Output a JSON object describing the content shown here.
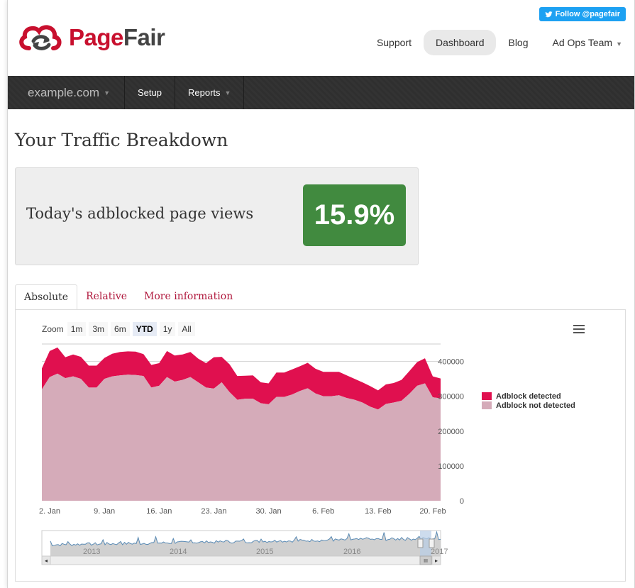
{
  "header": {
    "follow_label": "Follow @pagefair",
    "logo": {
      "part1": "Page",
      "part2": "Fair"
    },
    "nav": [
      {
        "label": "Support",
        "active": false
      },
      {
        "label": "Dashboard",
        "active": true
      },
      {
        "label": "Blog",
        "active": false
      },
      {
        "label": "Ad Ops Team",
        "active": false,
        "dropdown": true
      }
    ]
  },
  "subnav": {
    "site": "example.com",
    "setup": "Setup",
    "reports": "Reports"
  },
  "page_title": "Your Traffic Breakdown",
  "stat": {
    "label": "Today's adblocked page views",
    "value": "15.9%",
    "color": "#418a3f"
  },
  "tabs": [
    "Absolute",
    "Relative",
    "More information"
  ],
  "zoom": {
    "label": "Zoom",
    "options": [
      "1m",
      "3m",
      "6m",
      "YTD",
      "1y",
      "All"
    ],
    "selected": "YTD"
  },
  "chart_data": {
    "type": "area",
    "stacked": true,
    "x": [
      "1/1",
      "1/2",
      "1/3",
      "1/4",
      "1/5",
      "1/6",
      "1/7",
      "1/8",
      "1/9",
      "1/10",
      "1/11",
      "1/12",
      "1/13",
      "1/14",
      "1/15",
      "1/16",
      "1/17",
      "1/18",
      "1/19",
      "1/20",
      "1/21",
      "1/22",
      "1/23",
      "1/24",
      "1/25",
      "1/26",
      "1/27",
      "1/28",
      "1/29",
      "1/30",
      "1/31",
      "2/1",
      "2/2",
      "2/3",
      "2/4",
      "2/5",
      "2/6",
      "2/7",
      "2/8",
      "2/9",
      "2/10",
      "2/11",
      "2/12",
      "2/13",
      "2/14",
      "2/15",
      "2/16",
      "2/17",
      "2/18",
      "2/19",
      "2/20",
      "2/21"
    ],
    "x_ticks": [
      "2. Jan",
      "9. Jan",
      "16. Jan",
      "23. Jan",
      "30. Jan",
      "6. Feb",
      "13. Feb",
      "20. Feb"
    ],
    "y_ticks": [
      "400000",
      "300000",
      "200000",
      "100000",
      "0"
    ],
    "ylim": [
      0,
      450000
    ],
    "series": [
      {
        "name": "Adblock not detected",
        "color": "#d5abb9",
        "values": [
          320000,
          355000,
          365000,
          352000,
          357000,
          350000,
          325000,
          325000,
          350000,
          357000,
          360000,
          362000,
          361000,
          358000,
          325000,
          330000,
          355000,
          342000,
          347000,
          355000,
          340000,
          325000,
          322000,
          340000,
          312000,
          290000,
          293000,
          293000,
          280000,
          277000,
          298000,
          298000,
          305000,
          315000,
          323000,
          308000,
          300000,
          300000,
          303000,
          295000,
          290000,
          282000,
          270000,
          262000,
          278000,
          282000,
          287000,
          307000,
          330000,
          337000,
          297000,
          294000
        ]
      },
      {
        "name": "Adblock detected",
        "color": "#e0104f",
        "values": [
          60000,
          75000,
          75000,
          60000,
          63000,
          63000,
          63000,
          63000,
          60000,
          65000,
          67000,
          67000,
          67000,
          63000,
          65000,
          65000,
          75000,
          75000,
          73000,
          72000,
          68000,
          70000,
          90000,
          73000,
          80000,
          68000,
          66000,
          67000,
          60000,
          60000,
          70000,
          70000,
          72000,
          71000,
          73000,
          71000,
          70000,
          70000,
          67000,
          65000,
          60000,
          58000,
          59000,
          55000,
          56000,
          56000,
          60000,
          65000,
          68000,
          72000,
          60000,
          57000
        ]
      }
    ]
  },
  "navigator": {
    "years": [
      "2013",
      "2014",
      "2015",
      "2016",
      "2017"
    ],
    "handle_glyph": "III",
    "left_arrow": "◂",
    "right_arrow": "▸"
  }
}
